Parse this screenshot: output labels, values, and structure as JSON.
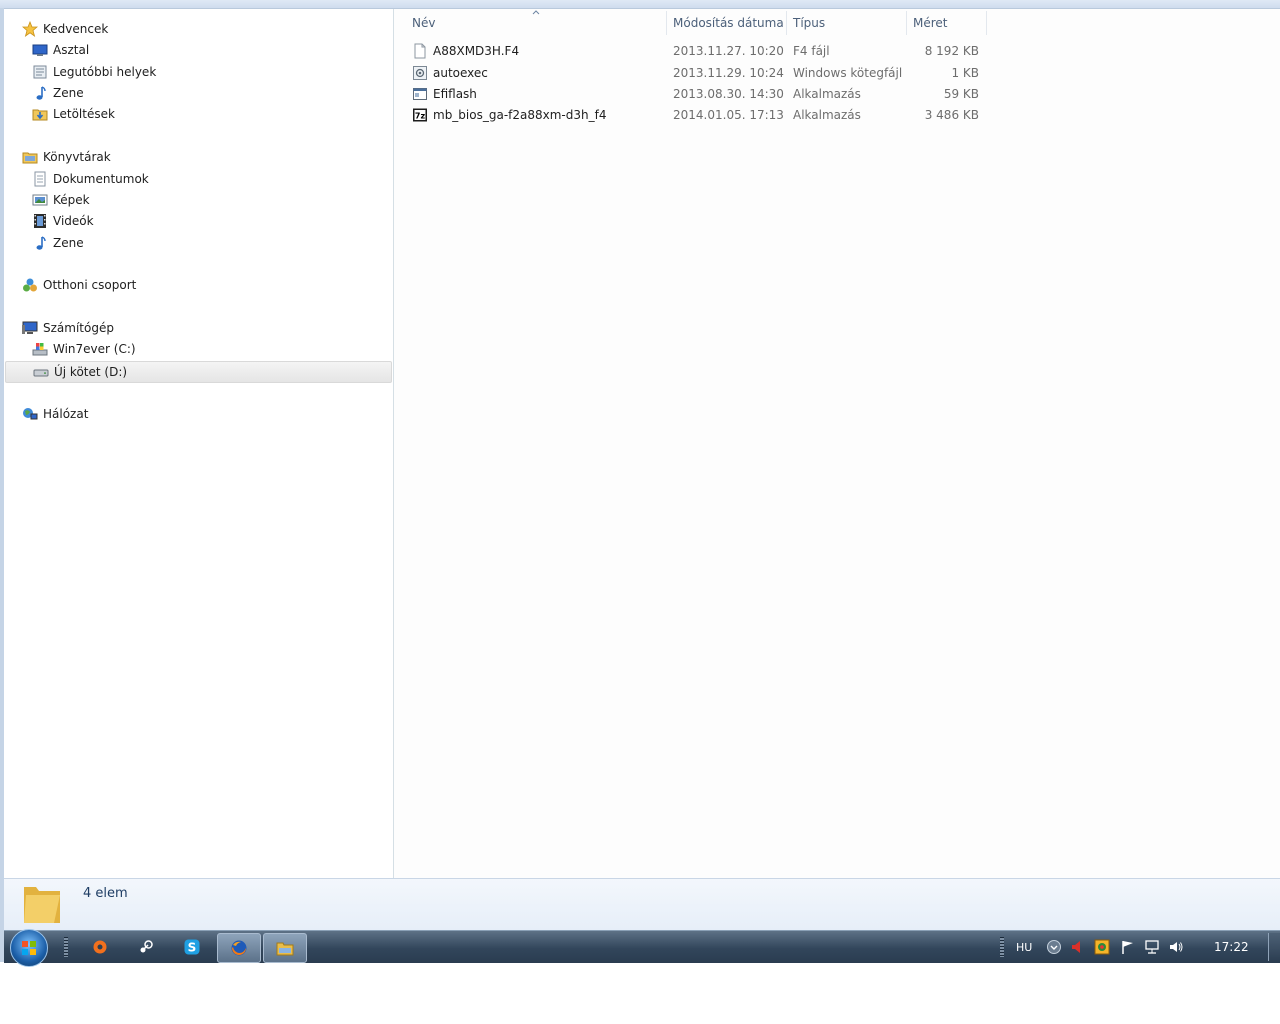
{
  "nav": {
    "favorites": {
      "label": "Kedvencek",
      "items": [
        {
          "label": "Asztal",
          "icon": "desktop-icon"
        },
        {
          "label": "Legutóbbi helyek",
          "icon": "recent-places-icon"
        },
        {
          "label": "Zene",
          "icon": "music-icon"
        },
        {
          "label": "Letöltések",
          "icon": "downloads-icon"
        }
      ]
    },
    "libraries": {
      "label": "Könyvtárak",
      "items": [
        {
          "label": "Dokumentumok",
          "icon": "documents-icon"
        },
        {
          "label": "Képek",
          "icon": "pictures-icon"
        },
        {
          "label": "Videók",
          "icon": "videos-icon"
        },
        {
          "label": "Zene",
          "icon": "music-icon"
        }
      ]
    },
    "homegroup": {
      "label": "Otthoni csoport"
    },
    "computer": {
      "label": "Számítógép",
      "items": [
        {
          "label": "Win7ever (C:)",
          "icon": "system-drive-icon"
        },
        {
          "label": "Új kötet (D:)",
          "icon": "drive-icon",
          "selected": true
        }
      ]
    },
    "network": {
      "label": "Hálózat"
    }
  },
  "columns": {
    "name": "Név",
    "date": "Módosítás dátuma",
    "type": "Típus",
    "size": "Méret"
  },
  "files": [
    {
      "name": "A88XMD3H.F4",
      "date": "2013.11.27. 10:20",
      "type": "F4 fájl",
      "size": "8 192 KB",
      "icon": "blank-file-icon"
    },
    {
      "name": "autoexec",
      "date": "2013.11.29. 10:24",
      "type": "Windows kötegfájl",
      "size": "1 KB",
      "icon": "batch-file-icon"
    },
    {
      "name": "Efiflash",
      "date": "2013.08.30. 14:30",
      "type": "Alkalmazás",
      "size": "59 KB",
      "icon": "application-icon"
    },
    {
      "name": "mb_bios_ga-f2a88xm-d3h_f4",
      "date": "2014.01.05. 17:13",
      "type": "Alkalmazás",
      "size": "3 486 KB",
      "icon": "7zip-icon"
    }
  ],
  "status": {
    "count": "4 elem"
  },
  "taskbar": {
    "lang": "HU",
    "time": "17:22"
  },
  "colors": {
    "accent": "#4c607a",
    "selection": "#e5e5e5",
    "taskbar": "#32465b"
  }
}
